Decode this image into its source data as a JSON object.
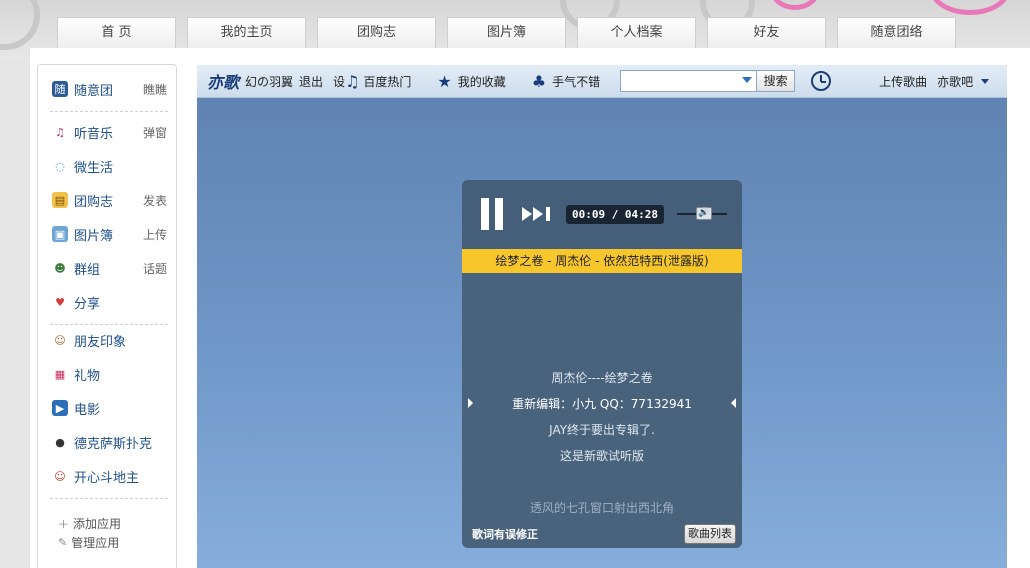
{
  "nav": {
    "tabs": [
      "首 页",
      "我的主页",
      "团购志",
      "图片簿",
      "个人档案",
      "好友",
      "随意团络"
    ]
  },
  "sidebar": {
    "items": [
      {
        "label": "随意团",
        "action": "瞧瞧",
        "icon": "calendar-icon"
      },
      {
        "label": "听音乐",
        "action": "弹窗",
        "icon": "music-icon"
      },
      {
        "label": "微生活",
        "action": "",
        "icon": "chat-bubble-icon"
      },
      {
        "label": "团购志",
        "action": "发表",
        "icon": "notebook-icon"
      },
      {
        "label": "图片簿",
        "action": "上传",
        "icon": "photo-icon"
      },
      {
        "label": "群组",
        "action": "话题",
        "icon": "group-icon"
      },
      {
        "label": "分享",
        "action": "",
        "icon": "heart-icon"
      },
      {
        "label": "朋友印象",
        "action": "",
        "icon": "person-icon"
      },
      {
        "label": "礼物",
        "action": "",
        "icon": "gift-icon"
      },
      {
        "label": "电影",
        "action": "",
        "icon": "film-icon"
      },
      {
        "label": "德克萨斯扑克",
        "action": "",
        "icon": "poker-chip-icon"
      },
      {
        "label": "开心斗地主",
        "action": "",
        "icon": "clown-icon"
      }
    ],
    "add_app": "添加应用",
    "manage_app": "管理应用"
  },
  "toolbar": {
    "logo": "亦歌",
    "user": "幻の羽翼",
    "logout": "退出",
    "settings": "设",
    "baidu_hot": "百度热门",
    "favorites": "我的收藏",
    "lucky": "手气不错",
    "search_placeholder": "",
    "search_button": "搜索",
    "upload": "上传歌曲",
    "yige_bar": "亦歌吧"
  },
  "player": {
    "time": "00:09 / 04:28",
    "now_playing": "绘梦之卷 - 周杰伦 - 依然范特西(泄露版)",
    "lyrics": [
      "周杰伦----绘梦之卷",
      "重新编辑：小九 QQ：77132941",
      "JAY终于要出专辑了.",
      "这是新歌试听版",
      "透风的七孔窗口射出西北角"
    ],
    "lyric_fix": "歌词有误修正",
    "song_list": "歌曲列表"
  }
}
